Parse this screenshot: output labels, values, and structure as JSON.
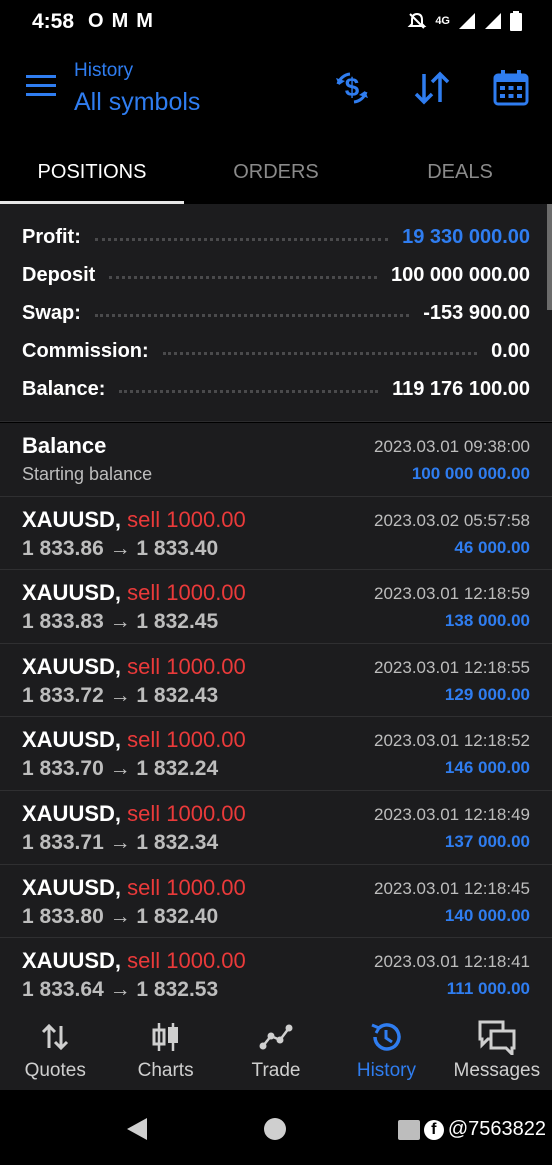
{
  "status_bar": {
    "time": "4:58",
    "left_icons": [
      "O",
      "M",
      "M"
    ],
    "network": "4G"
  },
  "header": {
    "subtitle": "History",
    "title": "All symbols",
    "actions": [
      "currency-exchange-icon",
      "sort-icon",
      "calendar-icon"
    ]
  },
  "tabs": [
    {
      "label": "POSITIONS",
      "active": true
    },
    {
      "label": "ORDERS",
      "active": false
    },
    {
      "label": "DEALS",
      "active": false
    }
  ],
  "summary": [
    {
      "label": "Profit:",
      "value": "19 330 000.00",
      "highlight": true
    },
    {
      "label": "Deposit",
      "value": "100 000 000.00",
      "highlight": false
    },
    {
      "label": "Swap:",
      "value": "-153 900.00",
      "highlight": false
    },
    {
      "label": "Commission:",
      "value": "0.00",
      "highlight": false
    },
    {
      "label": "Balance:",
      "value": "119 176 100.00",
      "highlight": false
    }
  ],
  "list": [
    {
      "symbol": "Balance",
      "side": "",
      "sub": "Starting balance",
      "time": "2023.03.01 09:38:00",
      "pl": "100 000 000.00",
      "kind": "balance"
    },
    {
      "symbol": "XAUUSD,",
      "side": " sell 1000.00",
      "sub": "1 833.86 → 1 833.40",
      "time": "2023.03.02 05:57:58",
      "pl": "46 000.00",
      "kind": "trade"
    },
    {
      "symbol": "XAUUSD,",
      "side": " sell 1000.00",
      "sub": "1 833.83 → 1 832.45",
      "time": "2023.03.01 12:18:59",
      "pl": "138 000.00",
      "kind": "trade"
    },
    {
      "symbol": "XAUUSD,",
      "side": " sell 1000.00",
      "sub": "1 833.72 → 1 832.43",
      "time": "2023.03.01 12:18:55",
      "pl": "129 000.00",
      "kind": "trade"
    },
    {
      "symbol": "XAUUSD,",
      "side": " sell 1000.00",
      "sub": "1 833.70 → 1 832.24",
      "time": "2023.03.01 12:18:52",
      "pl": "146 000.00",
      "kind": "trade"
    },
    {
      "symbol": "XAUUSD,",
      "side": " sell 1000.00",
      "sub": "1 833.71 → 1 832.34",
      "time": "2023.03.01 12:18:49",
      "pl": "137 000.00",
      "kind": "trade"
    },
    {
      "symbol": "XAUUSD,",
      "side": " sell 1000.00",
      "sub": "1 833.80 → 1 832.40",
      "time": "2023.03.01 12:18:45",
      "pl": "140 000.00",
      "kind": "trade"
    },
    {
      "symbol": "XAUUSD,",
      "side": " sell 1000.00",
      "sub": "1 833.64 → 1 832.53",
      "time": "2023.03.01 12:18:41",
      "pl": "111 000.00",
      "kind": "trade"
    }
  ],
  "bottom_nav": [
    {
      "label": "Quotes",
      "icon": "quotes-icon",
      "active": false
    },
    {
      "label": "Charts",
      "icon": "charts-icon",
      "active": false
    },
    {
      "label": "Trade",
      "icon": "trade-icon",
      "active": false
    },
    {
      "label": "History",
      "icon": "history-icon",
      "active": true
    },
    {
      "label": "Messages",
      "icon": "messages-icon",
      "active": false
    }
  ],
  "watermark": "@7563822",
  "colors": {
    "accent": "#2f7df0",
    "sell": "#ea3a3a",
    "panel": "#1c1c1e",
    "background": "#000000"
  }
}
